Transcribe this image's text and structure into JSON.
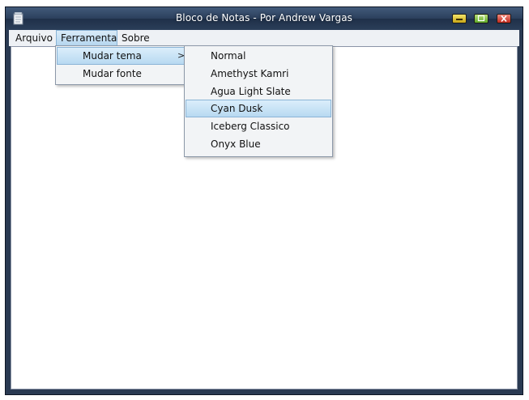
{
  "window": {
    "title": "Bloco de Notas - Por Andrew Vargas",
    "controls": {
      "minimize": "minimize",
      "maximize": "maximize",
      "close": "close"
    }
  },
  "menubar": {
    "items": [
      {
        "label": "Arquivo"
      },
      {
        "label": "Ferramenta"
      },
      {
        "label": "Sobre"
      }
    ]
  },
  "ferramenta_menu": {
    "items": [
      {
        "label": "Mudar tema",
        "has_submenu": true,
        "arrow": ">"
      },
      {
        "label": "Mudar fonte"
      }
    ]
  },
  "tema_submenu": {
    "items": [
      {
        "label": "Normal"
      },
      {
        "label": "Amethyst Kamri"
      },
      {
        "label": "Agua Light Slate"
      },
      {
        "label": "Cyan Dusk",
        "highlighted": true
      },
      {
        "label": "Iceberg Classico"
      },
      {
        "label": "Onyx Blue"
      }
    ]
  },
  "editor": {
    "content": ""
  },
  "colors": {
    "titlebar": "#2b3f5c",
    "menu_highlight": "#b8d9f1",
    "menu_background": "#f2f4f6"
  }
}
